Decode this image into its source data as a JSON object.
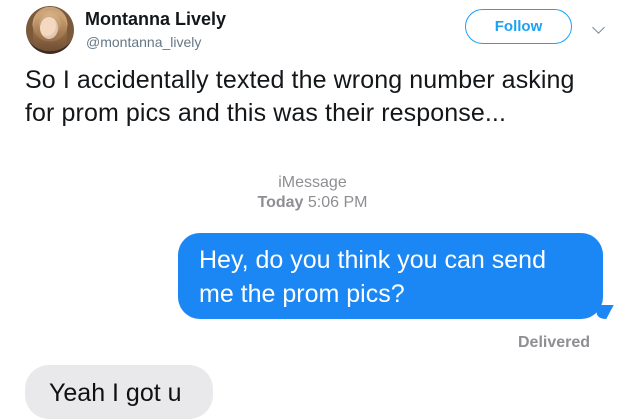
{
  "tweet": {
    "author": {
      "display_name": "Montanna Lively",
      "handle": "@montanna_lively"
    },
    "follow_label": "Follow",
    "text": "So I accidentally texted the wrong number asking for prom pics and this was their response...",
    "icons": {
      "more": "chevron-down-icon",
      "avatar": "avatar"
    },
    "colors": {
      "follow": "#1da1f2",
      "name": "#14171a",
      "handle": "#657786"
    }
  },
  "conversation": {
    "service": "iMessage",
    "timestamp_day": "Today",
    "timestamp_time": "5:06 PM",
    "messages": [
      {
        "direction": "sent",
        "text": "Hey, do you think you can send me the prom pics?"
      },
      {
        "direction": "received",
        "text": "Yeah I got u"
      }
    ],
    "delivered_label": "Delivered",
    "colors": {
      "sent_bubble": "#1b87f4",
      "received_bubble": "#e9e9eb",
      "meta_text": "#8e8e93"
    }
  }
}
